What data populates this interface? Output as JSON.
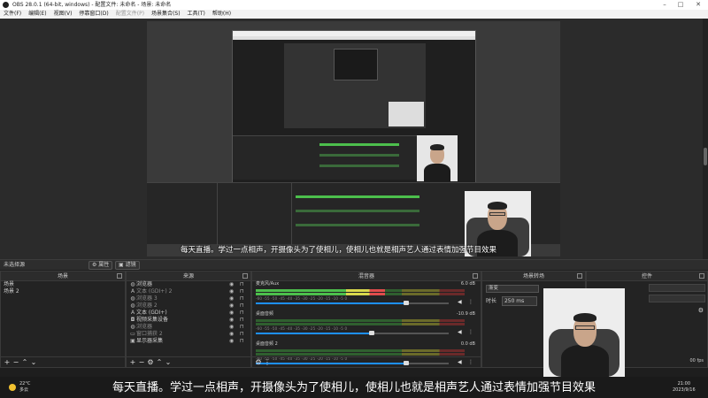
{
  "window": {
    "title": "OBS 28.0.1 (64-bit, windows) - 配置文件: 未命名 - 场景: 未命名"
  },
  "menu": {
    "items": [
      {
        "label": "文件(F)",
        "dim": false
      },
      {
        "label": "编辑(E)",
        "dim": false
      },
      {
        "label": "视图(V)",
        "dim": false
      },
      {
        "label": "停靠窗口(D)",
        "dim": false
      },
      {
        "label": "配置文件(P)",
        "dim": true
      },
      {
        "label": "场景集合(S)",
        "dim": false
      },
      {
        "label": "工具(T)",
        "dim": false
      },
      {
        "label": "帮助(H)",
        "dim": false
      }
    ]
  },
  "preview": {
    "subtitle": "每天直播。学过一点相声，开摄像头为了使相儿，使相儿也就是相声艺人通过表情加强节目效果"
  },
  "source_strip": {
    "label": "未选择源",
    "properties_label": "属性",
    "filters_label": "滤镜"
  },
  "scenes": {
    "title": "场景",
    "items": [
      "场景",
      "场景 2"
    ]
  },
  "sources": {
    "title": "来源",
    "items": [
      {
        "label": "浏览器",
        "icon": "globe-icon",
        "dim": false
      },
      {
        "label": "文本 (GDI+) 2",
        "icon": "text-icon",
        "dim": true
      },
      {
        "label": "浏览器 3",
        "icon": "globe-icon",
        "dim": true
      },
      {
        "label": "浏览器 2",
        "icon": "globe-icon",
        "dim": true
      },
      {
        "label": "文本 (GDI+)",
        "icon": "text-icon",
        "dim": false
      },
      {
        "label": "视频采集设备",
        "icon": "camera-icon",
        "dim": false
      },
      {
        "label": "浏览器",
        "icon": "globe-icon",
        "dim": true
      },
      {
        "label": "窗口捕获 2",
        "icon": "window-icon",
        "dim": true
      },
      {
        "label": "显示器采集",
        "icon": "monitor-icon",
        "dim": false
      }
    ]
  },
  "mixer": {
    "title": "混音器",
    "ticks": "-60 -55 -50 -45 -40 -35 -30 -25 -20 -15 -10 -5 0",
    "channels": [
      {
        "name": "麦克风/Aux",
        "db": "6.0 dB",
        "level": 0.62,
        "volume": 0.78
      },
      {
        "name": "桌面音频",
        "db": "-10.9 dB",
        "level": 0.0,
        "volume": 0.6
      },
      {
        "name": "桌面音频 2",
        "db": "0.0 dB",
        "level": 0.0,
        "volume": 0.78
      }
    ]
  },
  "transitions": {
    "title": "场景转场",
    "current": "渐变",
    "duration_label": "时长",
    "duration_value": "250 ms"
  },
  "controls": {
    "title": "控件",
    "fps": "00 fps"
  },
  "taskbar": {
    "temperature": "22°C",
    "weather": "多云",
    "time": "21:00",
    "date": "2023/9/16"
  },
  "caption": "每天直播。学过一点相声，开摄像头为了使相儿，使相儿也就是相声艺人通过表情加强节目效果"
}
